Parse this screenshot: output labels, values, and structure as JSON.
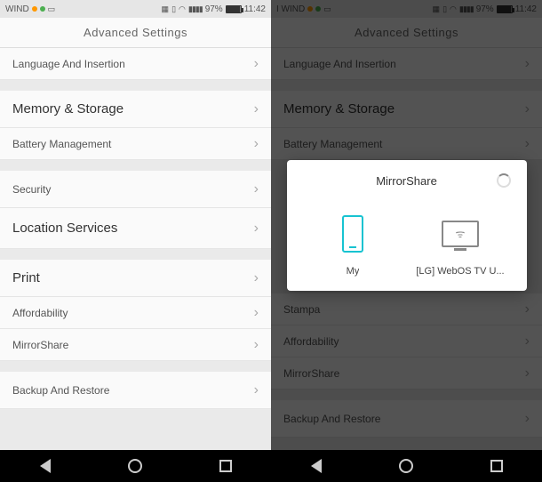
{
  "status": {
    "carrier_left": "WIND",
    "carrier_right": "I WIND",
    "battery_pct": "97%",
    "time": "11:42"
  },
  "header": {
    "title": "Advanced Settings"
  },
  "rows_left": {
    "language": "Language And Insertion",
    "memory": "Memory & Storage",
    "battery": "Battery Management",
    "security": "Security",
    "location": "Location Services",
    "print": "Print",
    "affordability": "Affordability",
    "mirrorshare": "MirrorShare",
    "backup": "Backup And Restore"
  },
  "rows_right": {
    "language": "Language And Insertion",
    "memory": "Memory & Storage",
    "battery": "Battery Management",
    "print": "Stampa",
    "affordability": "Affordability",
    "mirrorshare": "MirrorShare",
    "backup": "Backup And Restore"
  },
  "dialog": {
    "title": "MirrorShare",
    "device1": "My",
    "device2": "[LG] WebOS TV U..."
  }
}
